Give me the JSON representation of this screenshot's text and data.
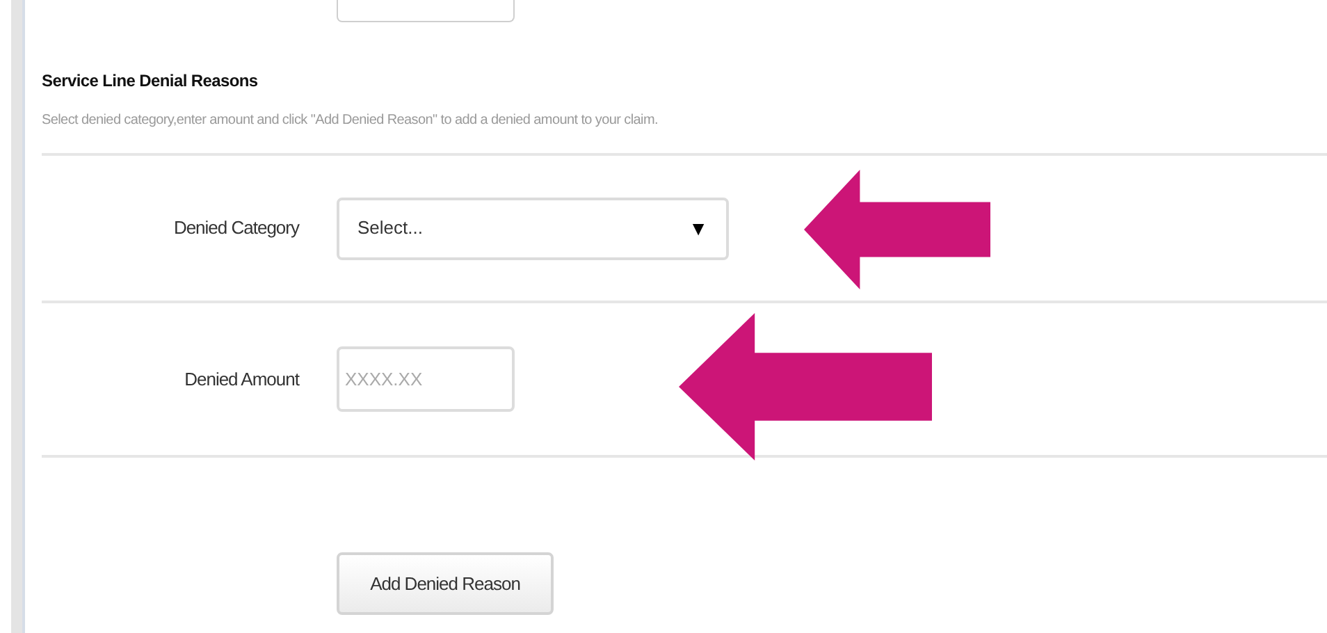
{
  "section": {
    "title": "Service Line Denial Reasons",
    "description": "Select denied category,enter amount and click \"Add Denied Reason\" to add a denied amount to your claim."
  },
  "fields": [
    {
      "kind": "select",
      "label": "Denied Category",
      "value": "Select...",
      "caret": "▼"
    },
    {
      "kind": "input",
      "label": "Denied Amount",
      "placeholder": "XXXX.XX"
    }
  ],
  "button": "Add Denied Reason"
}
